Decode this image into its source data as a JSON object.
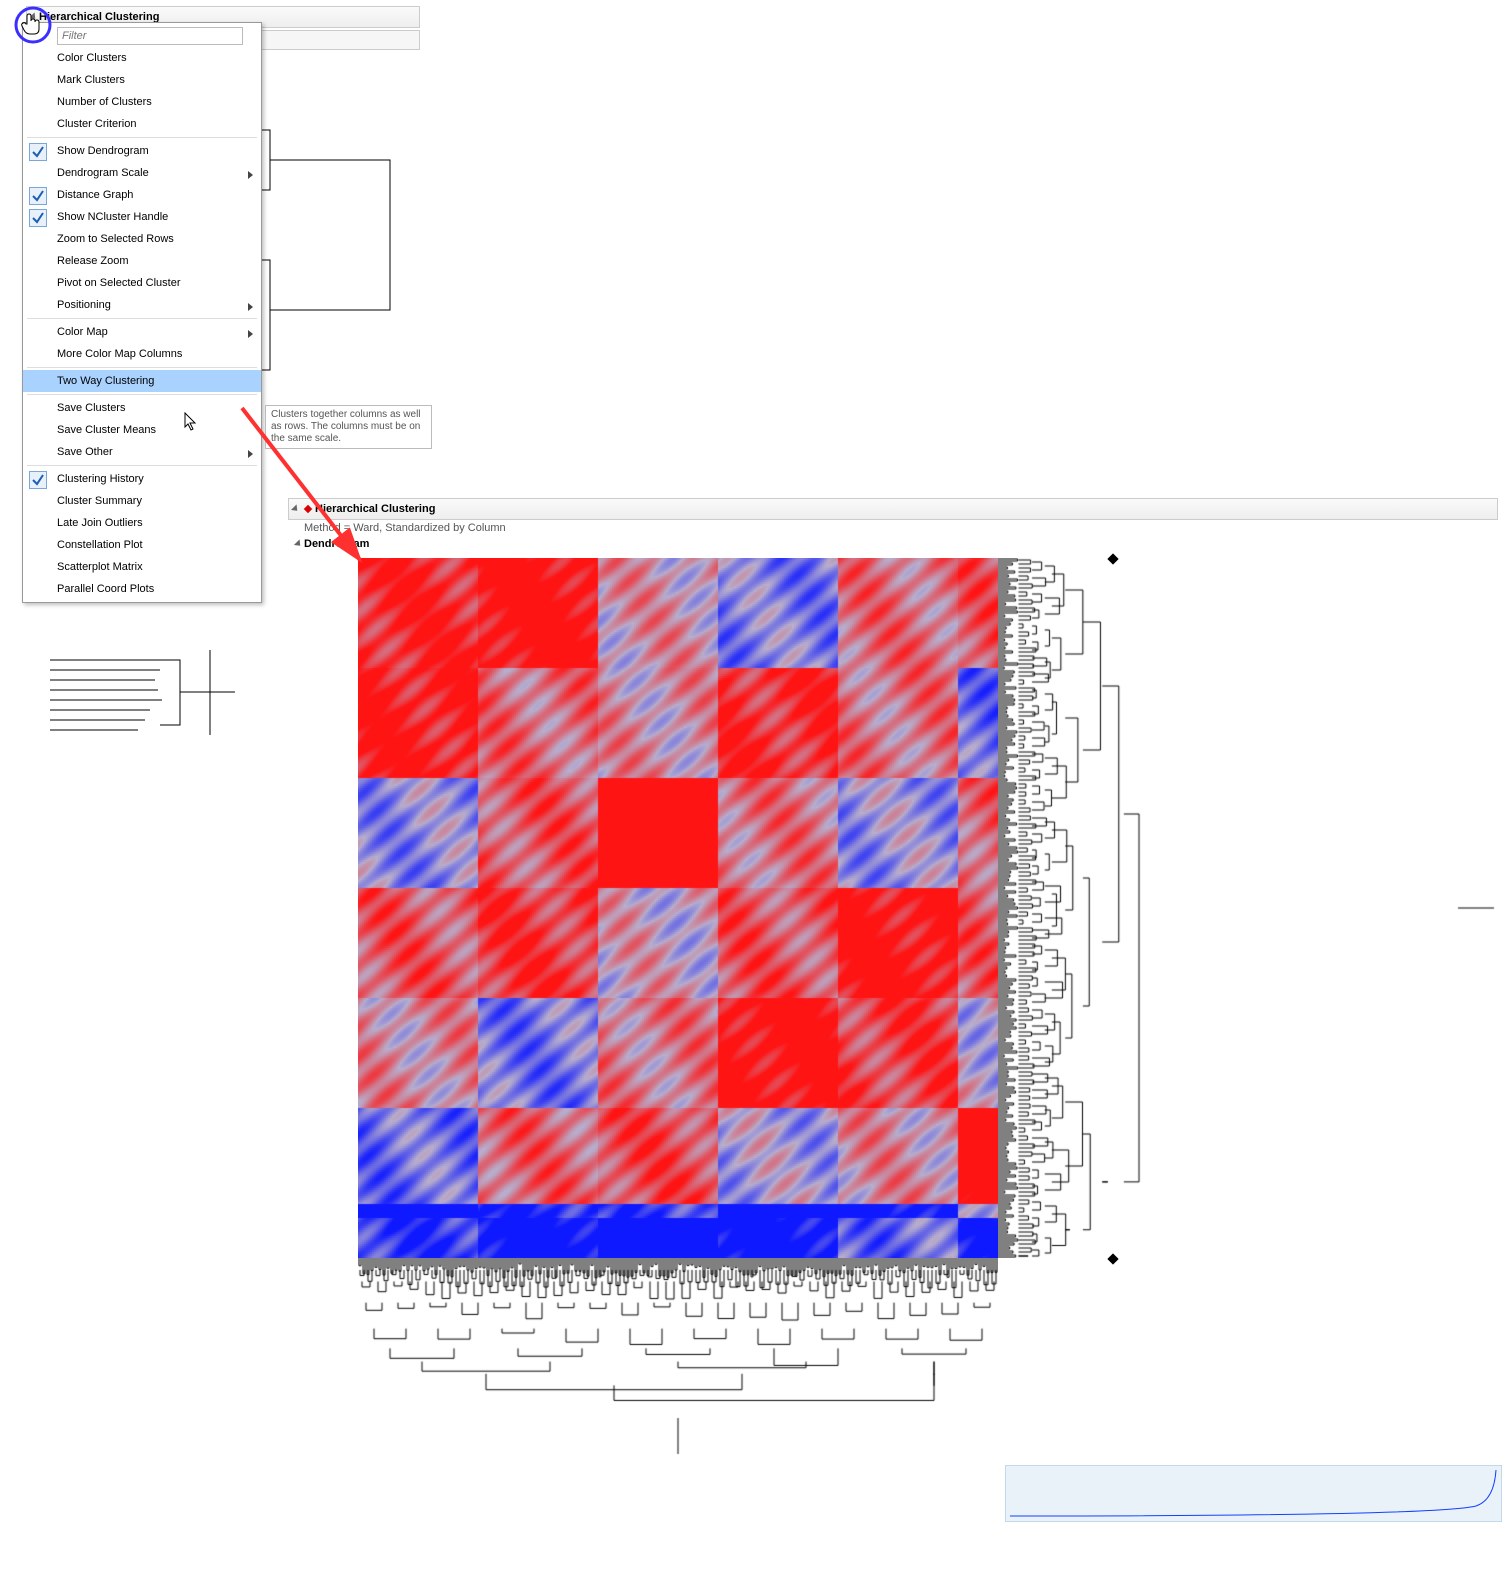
{
  "top_header": {
    "title": "Hierarchical Clustering"
  },
  "menu": {
    "filter_placeholder": "Filter",
    "items": [
      {
        "label": "Color Clusters",
        "checked": false,
        "submenu": false
      },
      {
        "label": "Mark Clusters",
        "checked": false,
        "submenu": false
      },
      {
        "label": "Number of Clusters",
        "checked": false,
        "submenu": false
      },
      {
        "label": "Cluster Criterion",
        "checked": false,
        "submenu": false
      },
      {
        "sep": true
      },
      {
        "label": "Show Dendrogram",
        "checked": true,
        "submenu": false
      },
      {
        "label": "Dendrogram Scale",
        "checked": false,
        "submenu": true
      },
      {
        "label": "Distance Graph",
        "checked": true,
        "submenu": false
      },
      {
        "label": "Show NCluster Handle",
        "checked": true,
        "submenu": false
      },
      {
        "label": "Zoom to Selected Rows",
        "checked": false,
        "submenu": false
      },
      {
        "label": "Release Zoom",
        "checked": false,
        "submenu": false
      },
      {
        "label": "Pivot on Selected Cluster",
        "checked": false,
        "submenu": false
      },
      {
        "label": "Positioning",
        "checked": false,
        "submenu": true
      },
      {
        "sep": true
      },
      {
        "label": "Color Map",
        "checked": false,
        "submenu": true
      },
      {
        "label": "More Color Map Columns",
        "checked": false,
        "submenu": false
      },
      {
        "sep": true
      },
      {
        "label": "Two Way Clustering",
        "checked": false,
        "submenu": false,
        "highlight": true
      },
      {
        "sep": true
      },
      {
        "label": "Save Clusters",
        "checked": false,
        "submenu": false
      },
      {
        "label": "Save Cluster Means",
        "checked": false,
        "submenu": false
      },
      {
        "label": "Save Other",
        "checked": false,
        "submenu": true
      },
      {
        "sep": true
      },
      {
        "label": "Clustering History",
        "checked": true,
        "submenu": false
      },
      {
        "label": "Cluster Summary",
        "checked": false,
        "submenu": false
      },
      {
        "label": "Late Join Outliers",
        "checked": false,
        "submenu": false
      },
      {
        "label": "Constellation Plot",
        "checked": false,
        "submenu": false
      },
      {
        "label": "Scatterplot Matrix",
        "checked": false,
        "submenu": false
      },
      {
        "label": "Parallel Coord Plots",
        "checked": false,
        "submenu": false
      }
    ]
  },
  "tooltip": {
    "text": "Clusters together columns as well as rows. The columns must be on the same scale."
  },
  "second_report": {
    "title": "Hierarchical Clustering",
    "subtitle": "Method = Ward, Standardized by Column",
    "dendrogram_title": "Dendrogram"
  },
  "colors": {
    "highlight": "#a9d2ff",
    "heatmap_low": "#1f3fff",
    "heatmap_mid": "#b8b8d8",
    "heatmap_high": "#ff1e1e",
    "annot_arrow": "#ff3030",
    "annot_circle": "#3a2fff"
  }
}
